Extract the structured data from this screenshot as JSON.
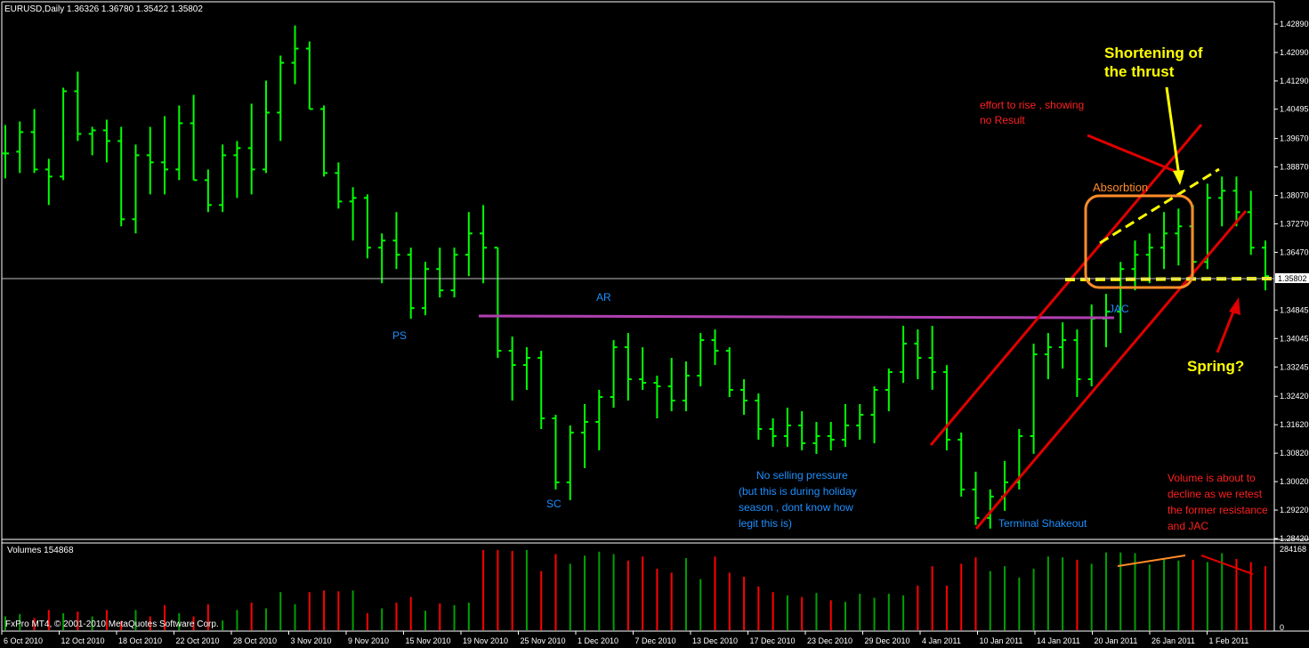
{
  "window": {
    "symbol_header": "EURUSD,Daily  1.36326 1.36780 1.35422 1.35802",
    "volume_header": "Volumes 154868",
    "copyright": "FxPro MT4, © 2001-2010 MetaQuotes Software Corp.",
    "current_price": "1.35802"
  },
  "price_axis": {
    "ticks": [
      "1.42890",
      "1.42090",
      "1.41290",
      "1.40495",
      "1.39670",
      "1.38870",
      "1.38070",
      "1.37270",
      "1.36470",
      "1.34845",
      "1.34045",
      "1.33245",
      "1.32420",
      "1.31620",
      "1.30820",
      "1.30020",
      "1.29220",
      "1.28420"
    ]
  },
  "volume_axis": {
    "ticks": [
      "284168",
      "0"
    ]
  },
  "date_axis": {
    "ticks": [
      "6 Oct 2010",
      "12 Oct 2010",
      "18 Oct 2010",
      "22 Oct 2010",
      "28 Oct 2010",
      "3 Nov 2010",
      "9 Nov 2010",
      "15 Nov 2010",
      "19 Nov 2010",
      "25 Nov 2010",
      "1 Dec 2010",
      "7 Dec 2010",
      "13 Dec 2010",
      "17 Dec 2010",
      "23 Dec 2010",
      "29 Dec 2010",
      "4 Jan 2011",
      "10 Jan 2011",
      "14 Jan 2011",
      "20 Jan 2011",
      "26 Jan 2011",
      "1 Feb 2011"
    ]
  },
  "annotations": {
    "ps": "PS",
    "ar": "AR",
    "sc": "SC",
    "jac": "JAC",
    "absorption": "Absorbtion",
    "spring": "Spring?",
    "shortening_l1": "Shortening of",
    "shortening_l2": "the thrust",
    "effort_l1": "effort to rise , showing",
    "effort_l2": "no Result",
    "no_selling_l1": "No selling pressure",
    "no_selling_l2": "(but this is during holiday",
    "no_selling_l3": "season , dont know how",
    "no_selling_l4": "legit this is)",
    "terminal": "Terminal Shakeout",
    "volume_l1": "Volume is about to",
    "volume_l2": "decline as we retest",
    "volume_l3": "the former resistance",
    "volume_l4": "and JAC"
  },
  "colors": {
    "bull": "#00ff00",
    "bear": "#00ff00",
    "vol_up": "#00a000",
    "vol_down": "#ff0000",
    "resistance": "#b040b0",
    "channel": "#e00000",
    "support_dash": "#ffff00",
    "label_blue": "#1e90ff",
    "label_red": "#ff2020",
    "label_yellow": "#ffff00",
    "label_orange": "#ff8c28"
  },
  "chart_data": {
    "type": "ohlc",
    "title": "EURUSD,Daily",
    "ylim": [
      1.2842,
      1.4289
    ],
    "dates": [
      "6 Oct",
      "7 Oct",
      "8 Oct",
      "11 Oct",
      "12 Oct",
      "13 Oct",
      "14 Oct",
      "15 Oct",
      "18 Oct",
      "19 Oct",
      "20 Oct",
      "21 Oct",
      "22 Oct",
      "25 Oct",
      "26 Oct",
      "27 Oct",
      "28 Oct",
      "29 Oct",
      "1 Nov",
      "2 Nov",
      "3 Nov",
      "4 Nov",
      "5 Nov",
      "8 Nov",
      "9 Nov",
      "10 Nov",
      "11 Nov",
      "12 Nov",
      "15 Nov",
      "16 Nov",
      "17 Nov",
      "18 Nov",
      "19 Nov",
      "22 Nov",
      "23 Nov",
      "24 Nov",
      "25 Nov",
      "26 Nov",
      "29 Nov",
      "30 Nov",
      "1 Dec",
      "2 Dec",
      "3 Dec",
      "6 Dec",
      "7 Dec",
      "8 Dec",
      "9 Dec",
      "10 Dec",
      "13 Dec",
      "14 Dec",
      "15 Dec",
      "16 Dec",
      "17 Dec",
      "20 Dec",
      "21 Dec",
      "22 Dec",
      "23 Dec",
      "24 Dec",
      "27 Dec",
      "28 Dec",
      "29 Dec",
      "30 Dec",
      "31 Dec",
      "3 Jan",
      "4 Jan",
      "5 Jan",
      "6 Jan",
      "7 Jan",
      "10 Jan",
      "11 Jan",
      "12 Jan",
      "13 Jan",
      "14 Jan",
      "17 Jan",
      "18 Jan",
      "19 Jan",
      "20 Jan",
      "21 Jan",
      "24 Jan",
      "25 Jan",
      "26 Jan",
      "27 Jan",
      "28 Jan",
      "31 Jan",
      "1 Feb",
      "2 Feb",
      "3 Feb",
      "4 Feb"
    ],
    "series": [
      {
        "name": "EURUSD",
        "ohlc": [
          [
            1.3925,
            1.4005,
            1.3855,
            1.3925
          ],
          [
            1.393,
            1.4015,
            1.387,
            1.3985
          ],
          [
            1.3985,
            1.405,
            1.387,
            1.388
          ],
          [
            1.388,
            1.391,
            1.378,
            1.386
          ],
          [
            1.386,
            1.411,
            1.385,
            1.41
          ],
          [
            1.41,
            1.4155,
            1.396,
            1.398
          ],
          [
            1.398,
            1.4,
            1.392,
            1.399
          ],
          [
            1.399,
            1.402,
            1.39,
            1.396
          ],
          [
            1.396,
            1.4,
            1.372,
            1.374
          ],
          [
            1.374,
            1.395,
            1.37,
            1.392
          ],
          [
            1.392,
            1.4,
            1.381,
            1.39
          ],
          [
            1.39,
            1.403,
            1.381,
            1.388
          ],
          [
            1.388,
            1.406,
            1.385,
            1.401
          ],
          [
            1.401,
            1.409,
            1.385,
            1.385
          ],
          [
            1.385,
            1.388,
            1.376,
            1.378
          ],
          [
            1.378,
            1.395,
            1.376,
            1.392
          ],
          [
            1.392,
            1.396,
            1.38,
            1.394
          ],
          [
            1.394,
            1.4065,
            1.381,
            1.388
          ],
          [
            1.388,
            1.413,
            1.387,
            1.404
          ],
          [
            1.404,
            1.42,
            1.396,
            1.418
          ],
          [
            1.418,
            1.4285,
            1.412,
            1.422
          ],
          [
            1.422,
            1.424,
            1.405,
            1.405
          ],
          [
            1.405,
            1.406,
            1.386,
            1.387
          ],
          [
            1.387,
            1.39,
            1.377,
            1.379
          ],
          [
            1.379,
            1.383,
            1.368,
            1.38
          ],
          [
            1.38,
            1.381,
            1.363,
            1.366
          ],
          [
            1.366,
            1.37,
            1.356,
            1.368
          ],
          [
            1.368,
            1.376,
            1.36,
            1.364
          ],
          [
            1.364,
            1.366,
            1.346,
            1.349
          ],
          [
            1.349,
            1.362,
            1.347,
            1.36
          ],
          [
            1.36,
            1.366,
            1.352,
            1.354
          ],
          [
            1.354,
            1.366,
            1.352,
            1.364
          ],
          [
            1.364,
            1.376,
            1.358,
            1.37
          ],
          [
            1.37,
            1.378,
            1.356,
            1.366
          ],
          [
            1.366,
            1.366,
            1.335,
            1.337
          ],
          [
            1.337,
            1.341,
            1.323,
            1.333
          ],
          [
            1.333,
            1.338,
            1.326,
            1.335
          ],
          [
            1.335,
            1.337,
            1.315,
            1.318
          ],
          [
            1.318,
            1.319,
            1.298,
            1.3
          ],
          [
            1.3,
            1.316,
            1.295,
            1.314
          ],
          [
            1.314,
            1.322,
            1.304,
            1.317
          ],
          [
            1.317,
            1.326,
            1.309,
            1.324
          ],
          [
            1.324,
            1.34,
            1.321,
            1.338
          ],
          [
            1.338,
            1.342,
            1.323,
            1.329
          ],
          [
            1.329,
            1.338,
            1.326,
            1.328
          ],
          [
            1.328,
            1.33,
            1.318,
            1.327
          ],
          [
            1.327,
            1.335,
            1.32,
            1.323
          ],
          [
            1.323,
            1.334,
            1.32,
            1.33
          ],
          [
            1.33,
            1.342,
            1.327,
            1.34
          ],
          [
            1.34,
            1.343,
            1.333,
            1.337
          ],
          [
            1.337,
            1.338,
            1.324,
            1.326
          ],
          [
            1.326,
            1.329,
            1.319,
            1.323
          ],
          [
            1.323,
            1.325,
            1.312,
            1.315
          ],
          [
            1.315,
            1.318,
            1.31,
            1.313
          ],
          [
            1.313,
            1.321,
            1.31,
            1.316
          ],
          [
            1.316,
            1.32,
            1.309,
            1.311
          ],
          [
            1.311,
            1.317,
            1.308,
            1.313
          ],
          [
            1.313,
            1.317,
            1.309,
            1.312
          ],
          [
            1.312,
            1.322,
            1.31,
            1.316
          ],
          [
            1.316,
            1.322,
            1.312,
            1.319
          ],
          [
            1.319,
            1.327,
            1.311,
            1.326
          ],
          [
            1.326,
            1.332,
            1.32,
            1.331
          ],
          [
            1.331,
            1.344,
            1.328,
            1.339
          ],
          [
            1.339,
            1.343,
            1.329,
            1.335
          ],
          [
            1.335,
            1.344,
            1.326,
            1.331
          ],
          [
            1.331,
            1.333,
            1.309,
            1.312
          ],
          [
            1.312,
            1.314,
            1.296,
            1.298
          ],
          [
            1.298,
            1.303,
            1.288,
            1.29
          ],
          [
            1.29,
            1.298,
            1.287,
            1.296
          ],
          [
            1.296,
            1.306,
            1.292,
            1.3
          ],
          [
            1.3,
            1.315,
            1.298,
            1.313
          ],
          [
            1.313,
            1.339,
            1.308,
            1.336
          ],
          [
            1.336,
            1.342,
            1.329,
            1.338
          ],
          [
            1.338,
            1.345,
            1.332,
            1.34
          ],
          [
            1.34,
            1.343,
            1.324,
            1.329
          ],
          [
            1.329,
            1.35,
            1.327,
            1.346
          ],
          [
            1.346,
            1.353,
            1.338,
            1.348
          ],
          [
            1.348,
            1.362,
            1.342,
            1.36
          ],
          [
            1.36,
            1.368,
            1.354,
            1.364
          ],
          [
            1.364,
            1.37,
            1.356,
            1.366
          ],
          [
            1.366,
            1.376,
            1.36,
            1.37
          ],
          [
            1.37,
            1.377,
            1.361,
            1.372
          ],
          [
            1.372,
            1.378,
            1.358,
            1.362
          ],
          [
            1.362,
            1.384,
            1.36,
            1.38
          ],
          [
            1.38,
            1.386,
            1.372,
            1.382
          ],
          [
            1.382,
            1.386,
            1.372,
            1.376
          ],
          [
            1.376,
            1.382,
            1.364,
            1.366
          ],
          [
            1.366,
            1.368,
            1.354,
            1.358
          ]
        ]
      },
      {
        "name": "Volumes",
        "values": [
          0.17,
          0.2,
          0.15,
          0.25,
          0.21,
          0.23,
          0.17,
          0.25,
          0.11,
          0.25,
          0.17,
          0.31,
          0.21,
          0.17,
          0.32,
          0.12,
          0.25,
          0.34,
          0.27,
          0.47,
          0.32,
          0.47,
          0.49,
          0.48,
          0.49,
          0.21,
          0.27,
          0.34,
          0.41,
          0.24,
          0.33,
          0.31,
          0.34,
          0.99,
          0.99,
          0.98,
          0.99,
          0.73,
          0.94,
          0.82,
          0.92,
          0.97,
          0.94,
          0.86,
          0.91,
          0.76,
          0.71,
          0.89,
          0.63,
          0.91,
          0.71,
          0.66,
          0.54,
          0.47,
          0.43,
          0.41,
          0.46,
          0.37,
          0.35,
          0.45,
          0.4,
          0.45,
          0.43,
          0.55,
          0.79,
          0.55,
          0.82,
          0.9,
          0.73,
          0.79,
          0.65,
          0.76,
          0.91,
          0.9,
          0.87,
          0.82,
          0.96,
          0.96,
          0.95,
          0.81,
          0.89,
          0.86,
          0.87,
          0.84,
          0.95,
          0.88,
          0.84,
          0.79
        ]
      }
    ],
    "levels": {
      "resistance_ar": 1.3466,
      "current": 1.35802
    }
  }
}
